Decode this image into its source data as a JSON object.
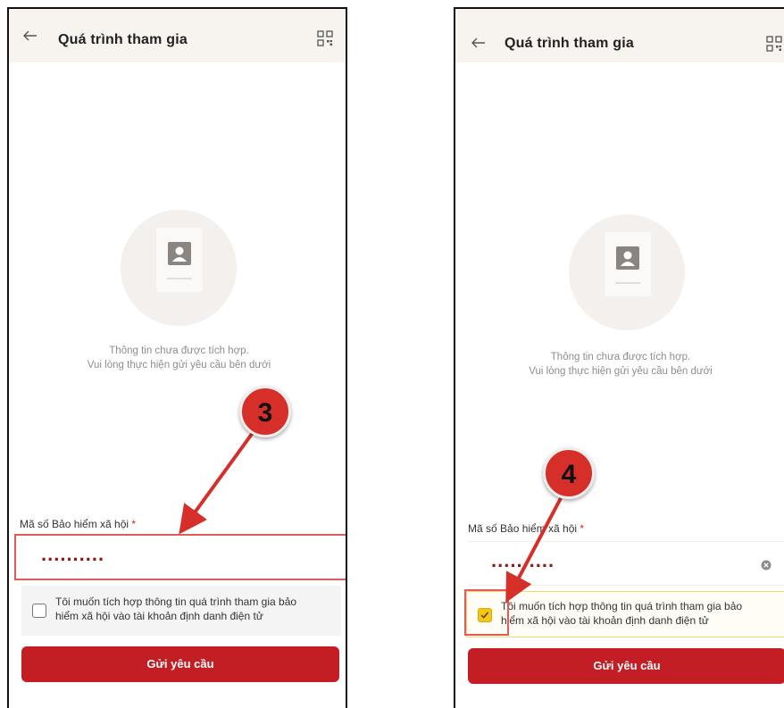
{
  "screens": [
    {
      "header_title": "Quá trình tham gia",
      "info_line1": "Thông tin chưa được tích hợp.",
      "info_line2": "Vui lòng thực hiện gửi yêu cầu bên dưới",
      "field_label": "Mã số Bảo hiểm xã hội",
      "required_mark": "*",
      "field_value": "..........",
      "consent_line1": "Tôi muốn tích hợp thông tin quá trình tham gia bảo",
      "consent_line2": "hiểm xã hội vào tài khoản định danh điện tử",
      "consent_checked": false,
      "submit_label": "Gửi yêu cầu",
      "step_number": "3"
    },
    {
      "header_title": "Quá trình tham gia",
      "info_line1": "Thông tin chưa được tích hợp.",
      "info_line2": "Vui lòng thực hiện gửi yêu cầu bên dưới",
      "field_label": "Mã số Bảo hiểm xã hội",
      "required_mark": "*",
      "field_value": "..........",
      "consent_line1": "Tôi muốn tích hợp thông tin quá trình tham gia bảo",
      "consent_line2": "hiểm xã hội vào tài khoản định danh điện tử",
      "consent_checked": true,
      "submit_label": "Gửi yêu cầu",
      "step_number": "4"
    }
  ],
  "colors": {
    "header_bg": "#f7f3ee",
    "brand_red": "#c41e25",
    "annotation_red": "#d62f2a",
    "checkbox_yellow": "#f5c518"
  },
  "icons": [
    "back-arrow-icon",
    "qr-code-icon",
    "person-card-icon",
    "clear-icon",
    "checkmark-icon"
  ]
}
